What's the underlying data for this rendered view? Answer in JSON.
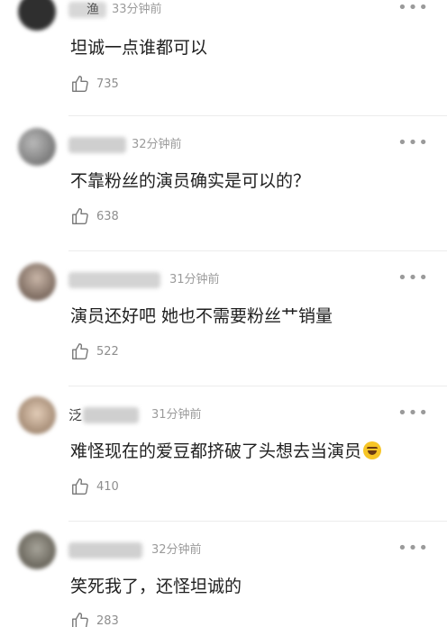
{
  "comments": [
    {
      "name": "渔",
      "time": "33分钟前",
      "text": "坦诚一点谁都可以",
      "likes": "735",
      "avatar_color": "#3a3a3a"
    },
    {
      "name": "",
      "time": "32分钟前",
      "text": "不靠粉丝的演员确实是可以的？",
      "likes": "638",
      "avatar_color": "#8c8c8c"
    },
    {
      "name": "",
      "time": "31分钟前",
      "text": "演员还好吧 她也不需要粉丝艹销量",
      "likes": "522",
      "avatar_color": "#7a6a60"
    },
    {
      "name": "泛",
      "time": "31分钟前",
      "text": "难怪现在的爱豆都挤破了头想去当演员",
      "likes": "410",
      "avatar_color": "#a88f78"
    },
    {
      "name": "",
      "time": "32分钟前",
      "text": "笑死我了，还怪坦诚的",
      "likes": "283",
      "avatar_color": "#6e6a5e"
    }
  ],
  "icons": {
    "more": "more-icon",
    "like": "thumbs-up-icon",
    "emoji": "laughing-emoji-icon"
  },
  "colors": {
    "time": "#9b9b9b",
    "text": "#1f1f1f",
    "divider": "#ececec"
  }
}
